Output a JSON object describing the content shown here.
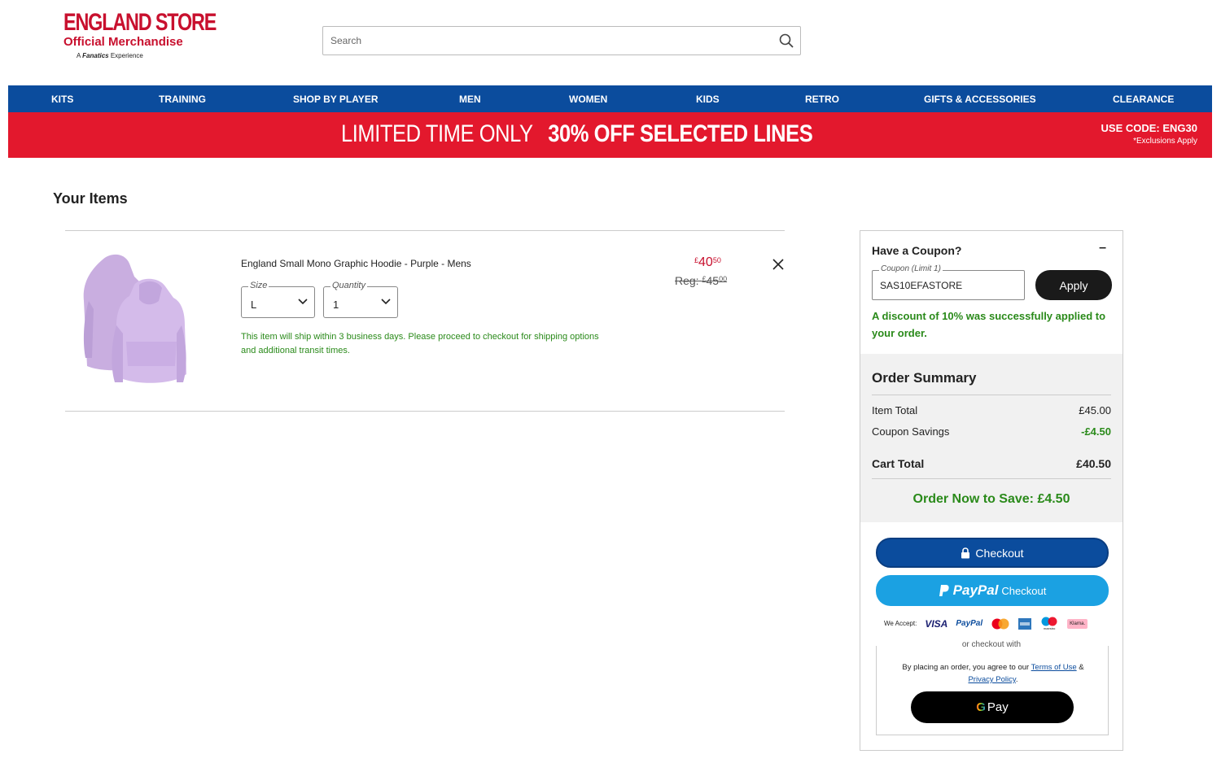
{
  "header": {
    "brand": "ENGLAND STORE",
    "brand_sub": "Official Merchandise",
    "brand_tag_prefix": "A",
    "brand_tag_name": "Fanatics",
    "brand_tag_suffix": "Experience",
    "search_placeholder": "Search"
  },
  "nav": {
    "items": [
      "KITS",
      "TRAINING",
      "SHOP BY PLAYER",
      "MEN",
      "WOMEN",
      "KIDS",
      "RETRO",
      "GIFTS & ACCESSORIES",
      "CLEARANCE"
    ]
  },
  "promo": {
    "light": "LIMITED TIME ONLY",
    "bold": "30% OFF SELECTED LINES",
    "code": "USE CODE: ENG30",
    "exclusions": "*Exclusions Apply"
  },
  "cart": {
    "title": "Your Items",
    "item": {
      "name": "England Small Mono Graphic Hoodie - Purple - Mens",
      "size_label": "Size",
      "size_value": "L",
      "qty_label": "Quantity",
      "qty_value": "1",
      "ship_msg": "This item will ship within 3 business days. Please proceed to checkout for shipping options and additional transit times.",
      "price_currency": "£",
      "price_main": "40",
      "price_pence": "50",
      "reg_label": "Reg:",
      "reg_currency": "£",
      "reg_main": "45",
      "reg_pence": "00"
    }
  },
  "coupon": {
    "title": "Have a Coupon?",
    "collapse": "–",
    "field_label": "Coupon (Limit 1)",
    "field_value": "SAS10EFASTORE",
    "apply": "Apply",
    "message": "A discount of 10% was successfully applied to your order."
  },
  "summary": {
    "title": "Order Summary",
    "item_total_label": "Item Total",
    "item_total": "£45.00",
    "coupon_label": "Coupon Savings",
    "coupon_value": "-£4.50",
    "cart_total_label": "Cart Total",
    "cart_total": "£40.50",
    "save_msg": "Order Now to Save: £4.50"
  },
  "payment": {
    "checkout": "Checkout",
    "paypal": "PayPal",
    "paypal_checkout": "Checkout",
    "we_accept": "We Accept:",
    "visa": "VISA",
    "paypal_small": "PayPal",
    "klarna": "Klarna.",
    "maestro": "maestro",
    "or_checkout": "or checkout with",
    "terms_prefix": "By placing an order, you agree to our",
    "terms_link": "Terms of Use",
    "terms_amp": "&",
    "privacy_link": "Privacy Policy",
    "gpay_g": "G",
    "gpay": "Pay"
  },
  "colors": {
    "nav_blue": "#0b4c9d",
    "promo_red": "#e3182d",
    "success_green": "#2a8a1a",
    "paypal_blue": "#1ba1e2"
  }
}
